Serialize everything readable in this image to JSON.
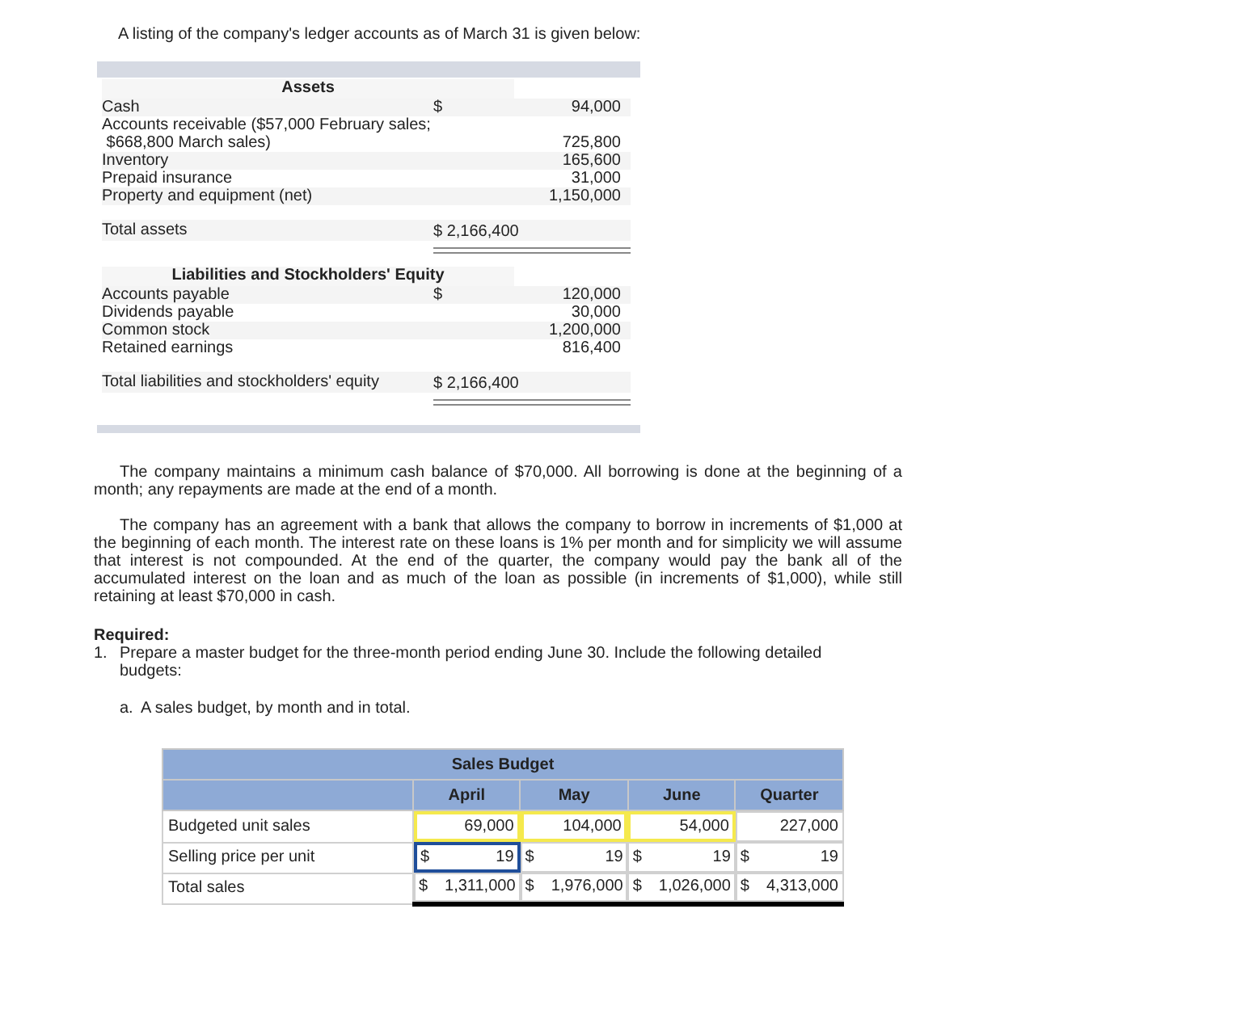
{
  "intro": "A listing of the company's ledger accounts as of March 31 is given below:",
  "ledger": {
    "sections": [
      {
        "title": "Assets",
        "rows": [
          {
            "label": [
              "Cash"
            ],
            "currency": "$",
            "amount": "94,000"
          },
          {
            "label": [
              "Accounts receivable ($57,000 February sales;",
              " $668,800 March sales)"
            ],
            "amount": "725,800"
          },
          {
            "label": [
              "Inventory"
            ],
            "amount": "165,600"
          },
          {
            "label": [
              "Prepaid insurance"
            ],
            "amount": "31,000"
          },
          {
            "label": [
              "Property and equipment (net)"
            ],
            "amount": "1,150,000"
          }
        ],
        "total": {
          "label": "Total assets",
          "amount": "$ 2,166,400"
        }
      },
      {
        "title": "Liabilities and Stockholders' Equity",
        "rows": [
          {
            "label": [
              "Accounts payable"
            ],
            "currency": "$",
            "amount": "120,000"
          },
          {
            "label": [
              "Dividends payable"
            ],
            "amount": "30,000"
          },
          {
            "label": [
              "Common stock"
            ],
            "amount": "1,200,000"
          },
          {
            "label": [
              "Retained earnings"
            ],
            "amount": "816,400"
          }
        ],
        "total": {
          "label": "Total liabilities and stockholders' equity",
          "amount": "$ 2,166,400"
        }
      }
    ]
  },
  "paragraphs": [
    "The company maintains a minimum cash balance of $70,000. All borrowing is done at the beginning of a month; any repayments are made at the end of a month.",
    "The company has an agreement with a bank that allows the company to borrow in increments of $1,000 at the beginning of each month. The interest rate on these loans is 1% per month and for simplicity we will assume that interest is not compounded. At the end of the quarter, the company would pay the bank all of the accumulated interest on the loan and as much of the loan as possible (in increments of $1,000), while still retaining at least $70,000 in cash."
  ],
  "required": {
    "heading": "Required:",
    "items": [
      {
        "marker": "1.",
        "text": "Prepare a master budget for the three-month period ending June 30. Include the following detailed budgets:"
      }
    ],
    "subitems": [
      {
        "marker": "a.",
        "text": "A sales budget, by month and in total."
      }
    ]
  },
  "sales_budget": {
    "title": "Sales Budget",
    "columns": [
      "April",
      "May",
      "June",
      "Quarter"
    ],
    "rows": [
      {
        "label": "Budgeted unit sales",
        "cells": [
          {
            "value": "69,000",
            "kind": "input",
            "focused": false
          },
          {
            "value": "104,000",
            "kind": "input",
            "focused": false
          },
          {
            "value": "54,000",
            "kind": "input",
            "focused": false
          },
          {
            "value": "227,000",
            "kind": "computed",
            "focused": false
          }
        ]
      },
      {
        "label": "Selling price per unit",
        "cells": [
          {
            "currency": "$",
            "value": "19",
            "kind": "input",
            "focused": true
          },
          {
            "currency": "$",
            "value": "19",
            "kind": "computed",
            "focused": false
          },
          {
            "currency": "$",
            "value": "19",
            "kind": "computed",
            "focused": false
          },
          {
            "currency": "$",
            "value": "19",
            "kind": "computed",
            "focused": false
          }
        ]
      },
      {
        "label": "Total sales",
        "total": true,
        "cells": [
          {
            "currency": "$",
            "value": "1,311,000",
            "kind": "computed",
            "focused": false
          },
          {
            "currency": "$",
            "value": "1,976,000",
            "kind": "computed",
            "focused": false
          },
          {
            "currency": "$",
            "value": "1,026,000",
            "kind": "computed",
            "focused": false
          },
          {
            "currency": "$",
            "value": "4,313,000",
            "kind": "computed",
            "focused": false
          }
        ]
      }
    ]
  }
}
